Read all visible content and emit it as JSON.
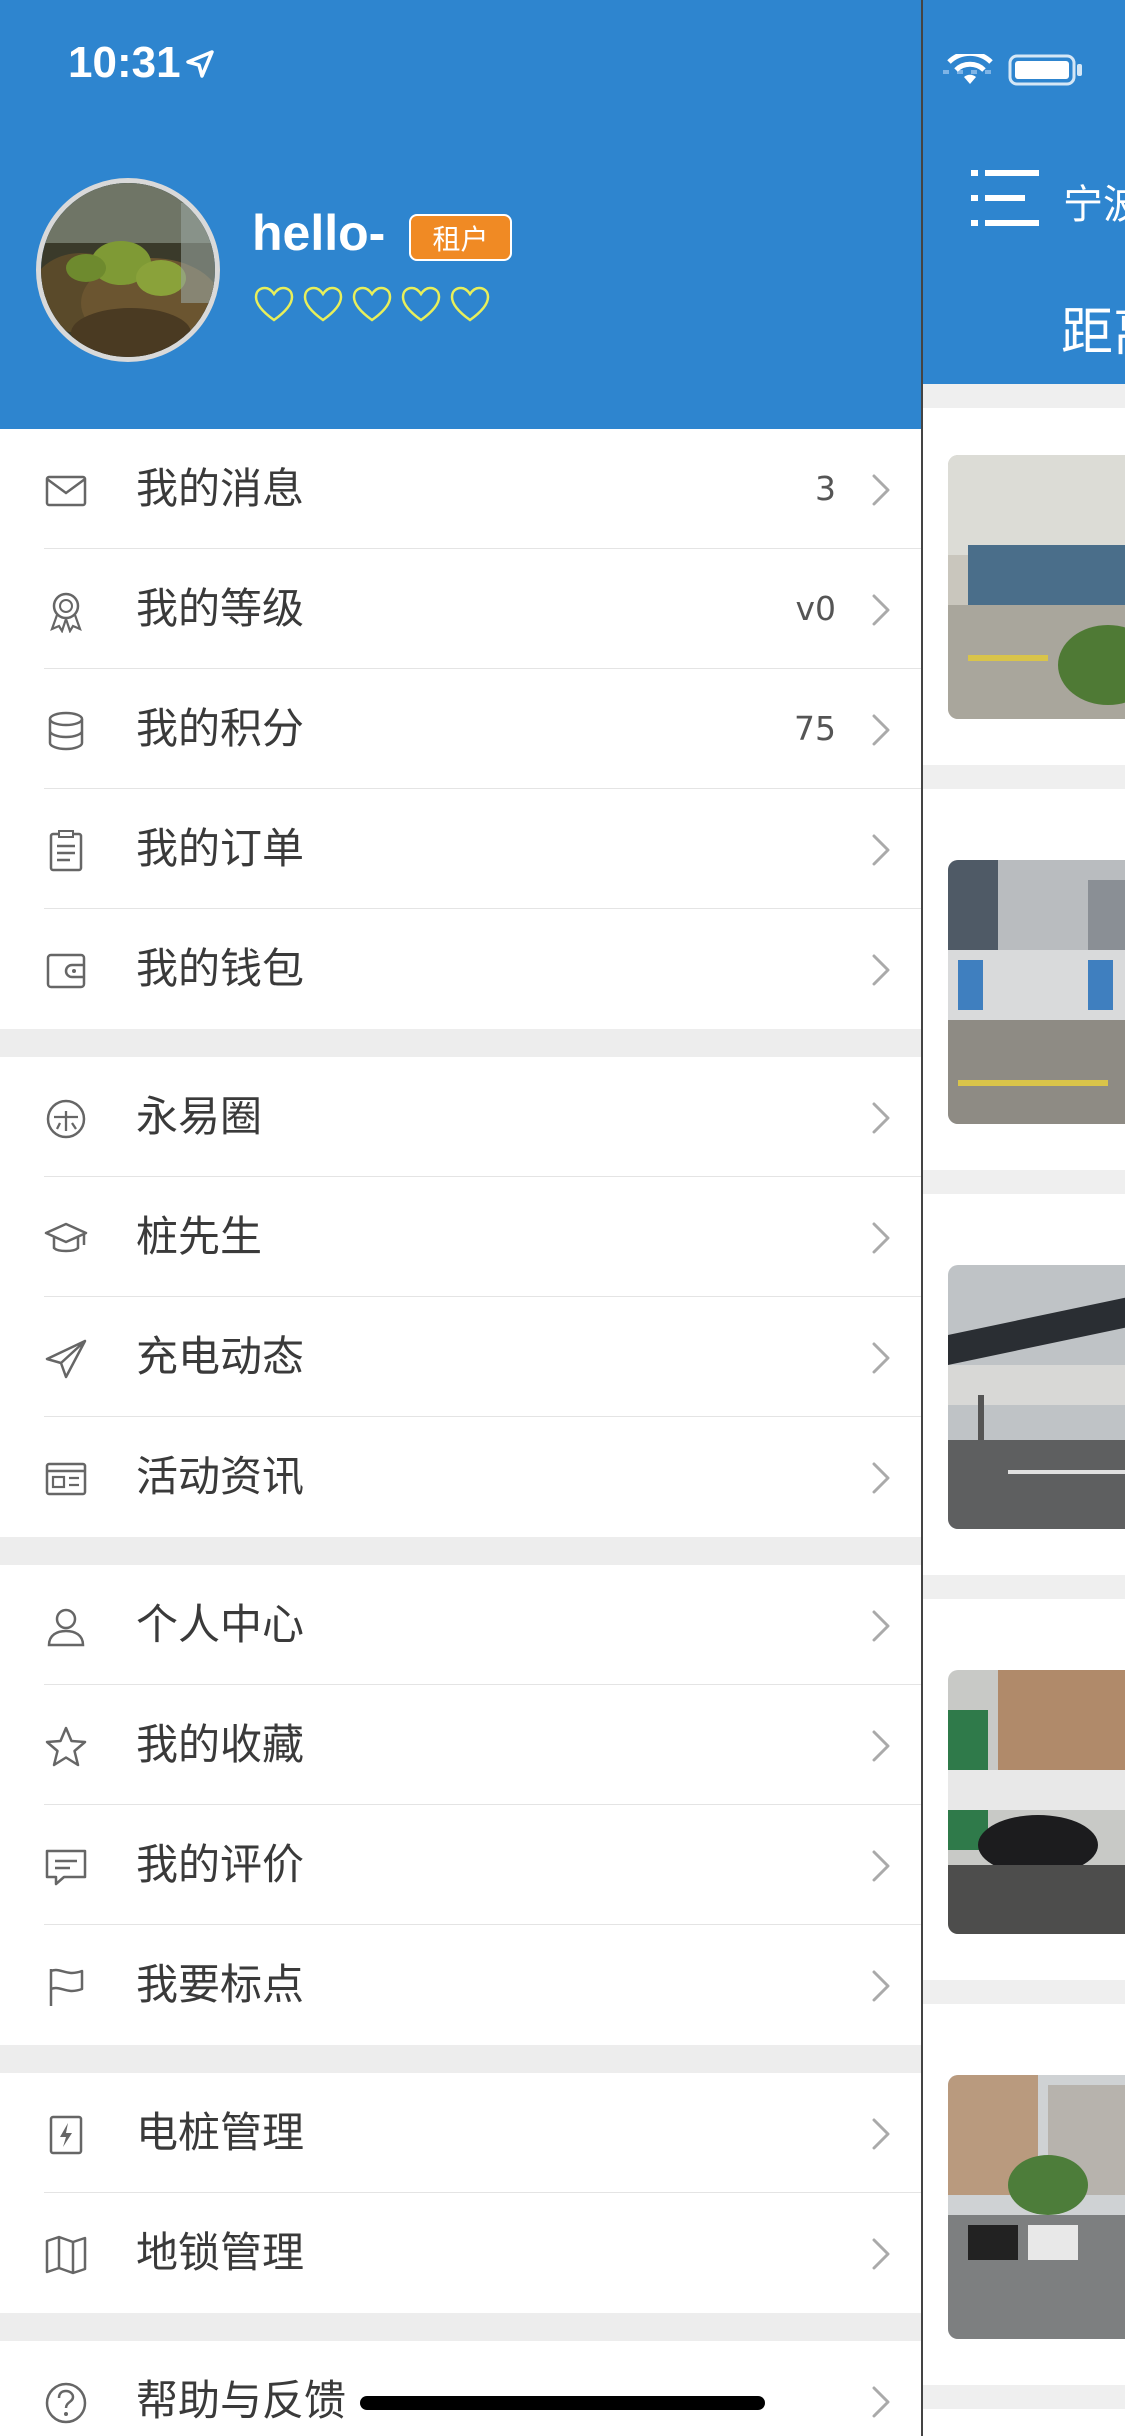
{
  "status_bar": {
    "time": "10:31"
  },
  "profile": {
    "name": "hello-",
    "role_badge": "租户",
    "rating_hearts": 5,
    "filled_hearts": 0
  },
  "menu_groups": [
    [
      {
        "icon": "mail-icon",
        "label": "我的消息",
        "value": "3"
      },
      {
        "icon": "medal-icon",
        "label": "我的等级",
        "value": "v0"
      },
      {
        "icon": "coins-icon",
        "label": "我的积分",
        "value": "75"
      },
      {
        "icon": "clipboard-icon",
        "label": "我的订单",
        "value": ""
      },
      {
        "icon": "wallet-icon",
        "label": "我的钱包",
        "value": ""
      }
    ],
    [
      {
        "icon": "circle-logo-icon",
        "label": "永易圈",
        "value": ""
      },
      {
        "icon": "graduation-cap-icon",
        "label": "桩先生",
        "value": ""
      },
      {
        "icon": "paper-plane-icon",
        "label": "充电动态",
        "value": ""
      },
      {
        "icon": "newspaper-icon",
        "label": "活动资讯",
        "value": ""
      }
    ],
    [
      {
        "icon": "person-icon",
        "label": "个人中心",
        "value": ""
      },
      {
        "icon": "star-icon",
        "label": "我的收藏",
        "value": ""
      },
      {
        "icon": "comment-icon",
        "label": "我的评价",
        "value": ""
      },
      {
        "icon": "flag-icon",
        "label": "我要标点",
        "value": ""
      }
    ],
    [
      {
        "icon": "charger-icon",
        "label": "电桩管理",
        "value": ""
      },
      {
        "icon": "map-icon",
        "label": "地锁管理",
        "value": ""
      }
    ],
    [
      {
        "icon": "help-icon",
        "label": "帮助与反馈",
        "value": ""
      }
    ]
  ],
  "main_panel": {
    "city": "宁波",
    "distance_label": "距离",
    "station_photos": [
      "station-photo-1",
      "station-photo-2",
      "station-photo-3",
      "station-photo-4",
      "station-photo-5"
    ]
  },
  "colors": {
    "header_blue": "#2e85cf",
    "badge_orange": "#f08a24",
    "heart_yellow": "#e8ef5a"
  }
}
